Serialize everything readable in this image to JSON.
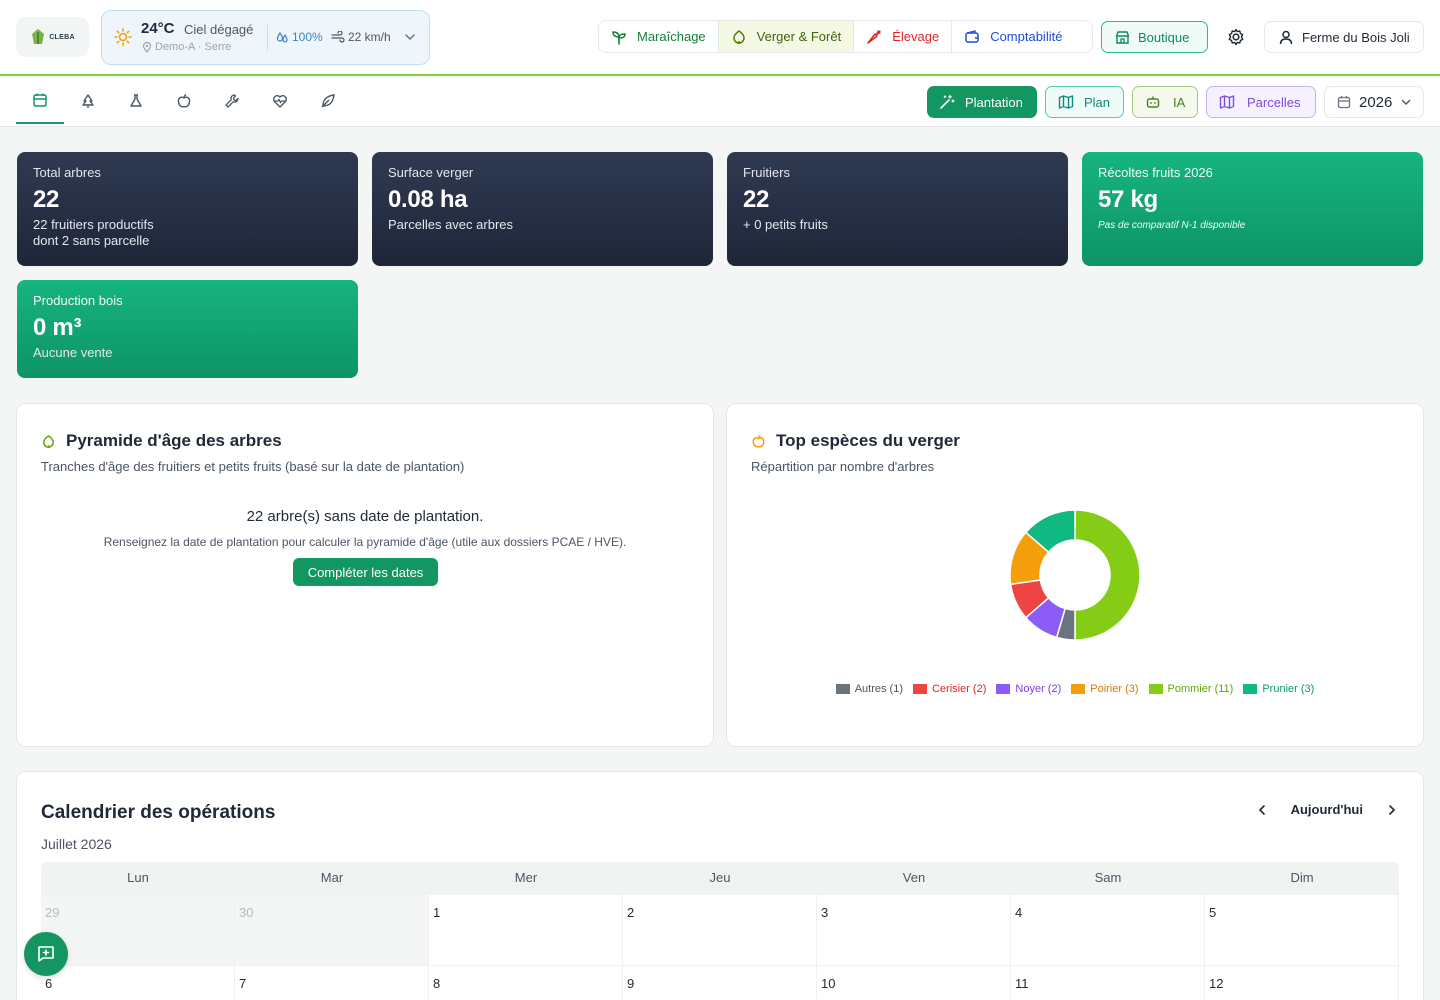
{
  "brand": {
    "logo_text": "CLEBA"
  },
  "weather": {
    "temperature": "24°C",
    "condition": "Ciel dégagé",
    "location": "Demo-A · Serre",
    "humidity": "100%",
    "wind": "22 km/h"
  },
  "modules": [
    {
      "label": "Maraîchage",
      "icon": "sprout-icon"
    },
    {
      "label": "Verger & Forêt",
      "icon": "leaf-icon"
    },
    {
      "label": "Élevage",
      "icon": "carrot-icon"
    },
    {
      "label": "Comptabilité",
      "icon": "wallet-icon"
    }
  ],
  "header": {
    "shop_label": "Boutique",
    "farm_name": "Ferme du Bois Joli"
  },
  "subnav": {
    "tabs": [
      "calendar-icon",
      "tree-icon",
      "flask-icon",
      "apple-icon",
      "wrench-icon",
      "heart-pulse-icon",
      "leaf-icon"
    ],
    "actions": {
      "plantation": "Plantation",
      "plan": "Plan",
      "ia": "IA",
      "parcelles": "Parcelles",
      "year": "2026"
    }
  },
  "kpis": [
    {
      "label": "Total arbres",
      "value": "22",
      "sub1": "22 fruitiers productifs",
      "sub2": "dont 2 sans parcelle"
    },
    {
      "label": "Surface verger",
      "value": "0.08 ha",
      "sub1": "Parcelles avec arbres"
    },
    {
      "label": "Fruitiers",
      "value": "22",
      "sub1": "+ 0 petits fruits"
    },
    {
      "label": "Récoltes fruits 2026",
      "value": "57 kg",
      "sub1": "Pas de comparatif N-1 disponible"
    },
    {
      "label": "Production bois",
      "value": "0 m³",
      "sub1": "Aucune vente"
    }
  ],
  "age_pyramid": {
    "title": "Pyramide d'âge des arbres",
    "subtitle": "Tranches d'âge des fruitiers et petits fruits (basé sur la date de plantation)",
    "empty_message": "22 arbre(s) sans date de plantation.",
    "empty_hint": "Renseignez la date de plantation pour calculer la pyramide d'âge (utile aux dossiers PCAE / HVE).",
    "button": "Compléter les dates"
  },
  "top_species": {
    "title": "Top espèces du verger",
    "subtitle": "Répartition par nombre d'arbres"
  },
  "chart_data": {
    "type": "pie",
    "donut": true,
    "categories": [
      "Autres",
      "Cerisier",
      "Noyer",
      "Poirier",
      "Pommier",
      "Prunier"
    ],
    "values": [
      1,
      2,
      2,
      3,
      11,
      3
    ],
    "legend_labels": [
      "Autres (1)",
      "Cerisier (2)",
      "Noyer (2)",
      "Poirier (3)",
      "Pommier (11)",
      "Prunier (3)"
    ],
    "colors": [
      "#6b7280",
      "#ef4444",
      "#8b5cf6",
      "#f59e0b",
      "#84cc16",
      "#10b981"
    ],
    "legend_text_colors": [
      "#4b5563",
      "#dc2626",
      "#7c3aed",
      "#d97706",
      "#65a30d",
      "#0f9a6e"
    ],
    "legend_placement": "bottom"
  },
  "calendar": {
    "title": "Calendrier des opérations",
    "month": "Juillet 2026",
    "today_label": "Aujourd'hui",
    "weekdays": [
      "Lun",
      "Mar",
      "Mer",
      "Jeu",
      "Ven",
      "Sam",
      "Dim"
    ],
    "days": [
      {
        "n": "29",
        "out": true
      },
      {
        "n": "30",
        "out": true
      },
      {
        "n": "1"
      },
      {
        "n": "2"
      },
      {
        "n": "3"
      },
      {
        "n": "4"
      },
      {
        "n": "5"
      },
      {
        "n": "6"
      },
      {
        "n": "7"
      },
      {
        "n": "8"
      },
      {
        "n": "9"
      },
      {
        "n": "10"
      },
      {
        "n": "11"
      },
      {
        "n": "12"
      }
    ]
  }
}
